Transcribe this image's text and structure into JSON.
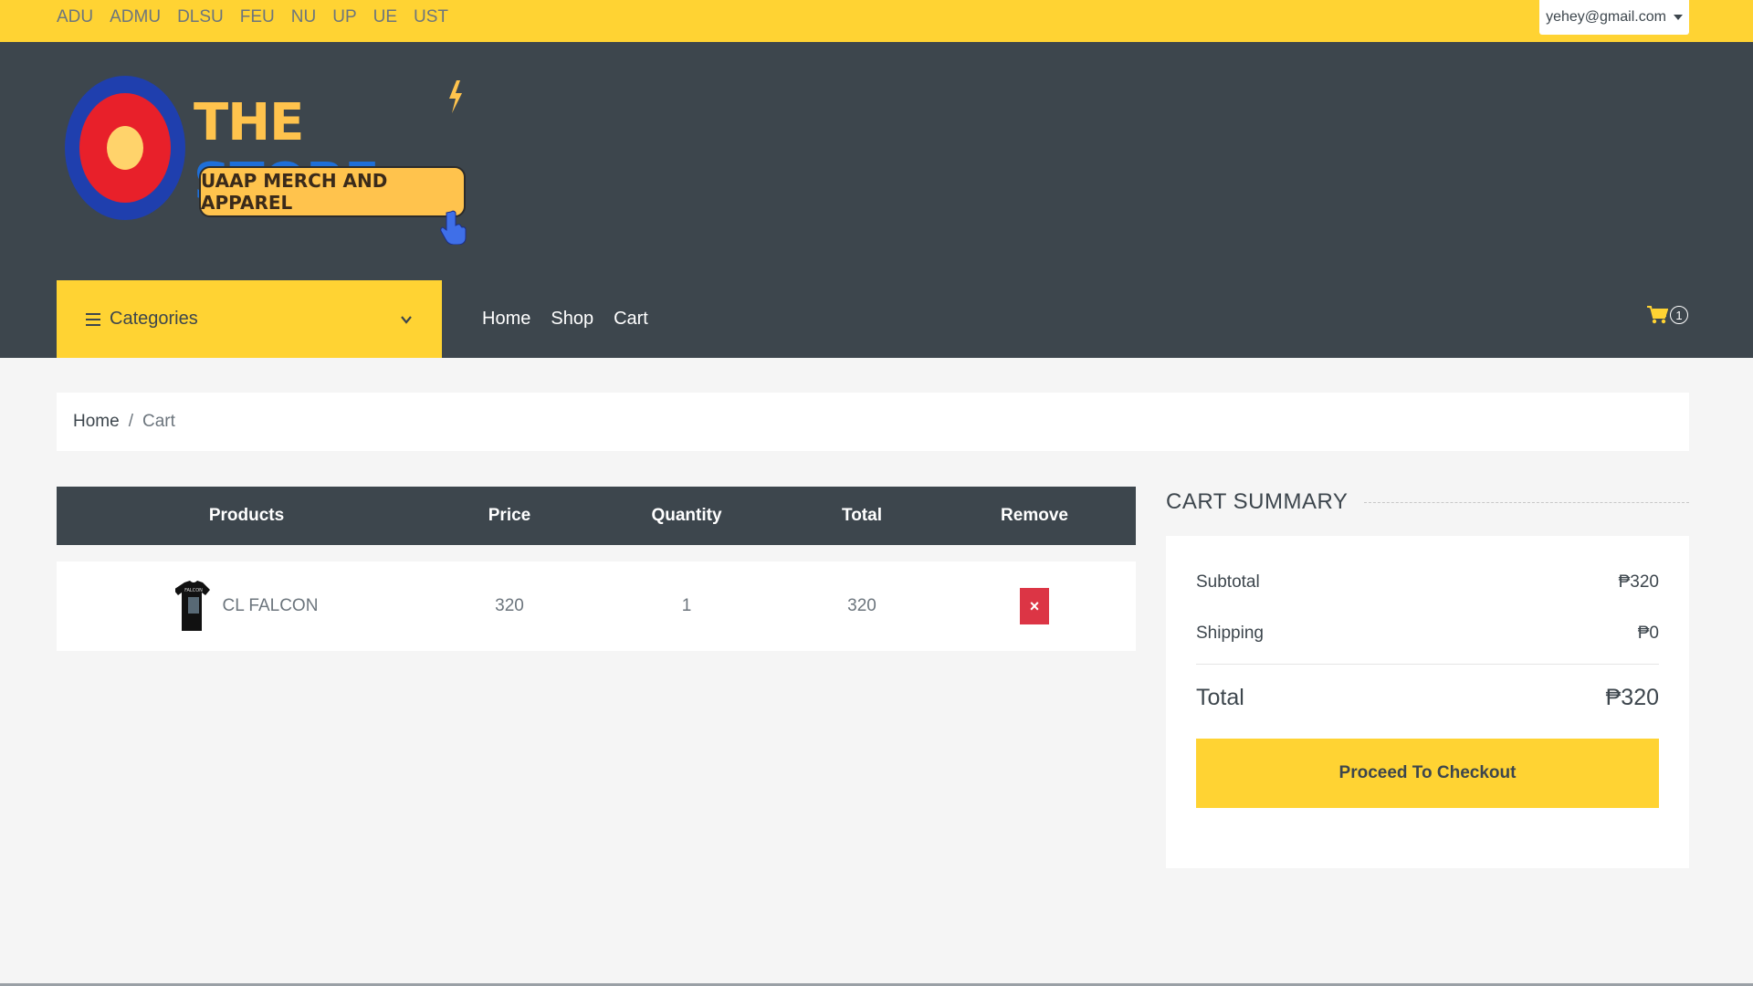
{
  "topbar": {
    "schools": [
      "ADU",
      "ADMU",
      "DLSU",
      "FEU",
      "NU",
      "UP",
      "UE",
      "UST"
    ],
    "account_email": "yehey@gmail.com"
  },
  "logo": {
    "word1": "THE",
    "word2": "STORE",
    "tagline": "UAAP MERCH AND APPAREL"
  },
  "navbar": {
    "categories_label": "Categories",
    "links": [
      "Home",
      "Shop",
      "Cart"
    ],
    "cart_count": "1"
  },
  "breadcrumb": {
    "home": "Home",
    "separator": "/",
    "current": "Cart"
  },
  "cart_table": {
    "headers": [
      "Products",
      "Price",
      "Quantity",
      "Total",
      "Remove"
    ],
    "rows": [
      {
        "product": "CL FALCON",
        "price": "320",
        "quantity": "1",
        "total": "320",
        "remove": "×"
      }
    ]
  },
  "summary": {
    "title": "CART SUMMARY",
    "subtotal_label": "Subtotal",
    "subtotal_value": "₱320",
    "shipping_label": "Shipping",
    "shipping_value": "₱0",
    "total_label": "Total",
    "total_value": "₱320",
    "checkout_label": "Proceed To Checkout"
  },
  "colors": {
    "accent": "#ffd333",
    "dark": "#3d464d",
    "danger": "#dc3545",
    "logo_blue": "#1e6fd9",
    "logo_gold": "#ffc34d"
  },
  "icons": [
    "hamburger-icon",
    "chevron-down-icon",
    "cart-icon",
    "remove-icon",
    "caret-down-icon",
    "bolt-icon",
    "pointer-hand-icon",
    "shirt-thumbnail"
  ]
}
